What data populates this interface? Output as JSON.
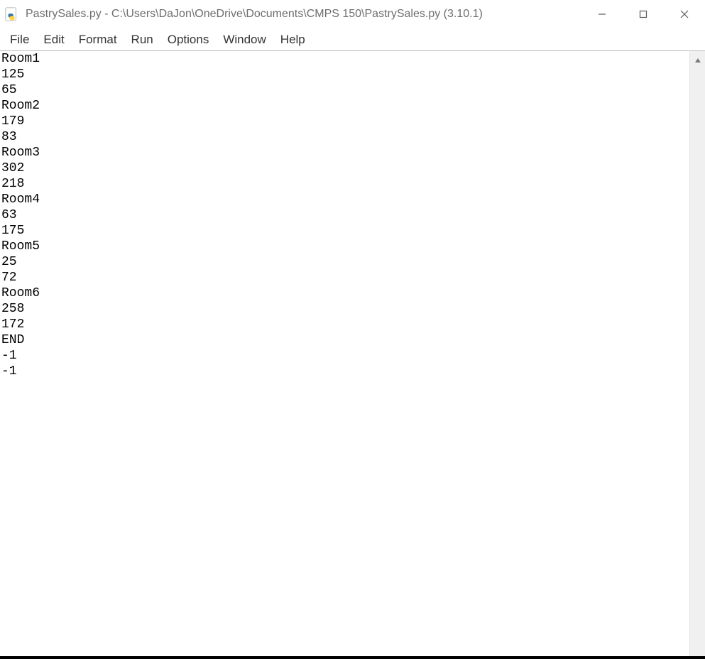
{
  "window": {
    "title": "PastrySales.py - C:\\Users\\DaJon\\OneDrive\\Documents\\CMPS 150\\PastrySales.py (3.10.1)"
  },
  "menu": {
    "items": [
      "File",
      "Edit",
      "Format",
      "Run",
      "Options",
      "Window",
      "Help"
    ]
  },
  "editor": {
    "lines": [
      "Room1",
      "125",
      "65",
      "Room2",
      "179",
      "83",
      "Room3",
      "302",
      "218",
      "Room4",
      "63",
      "175",
      "Room5",
      "25",
      "72",
      "Room6",
      "258",
      "172",
      "END",
      "-1",
      "-1"
    ]
  }
}
